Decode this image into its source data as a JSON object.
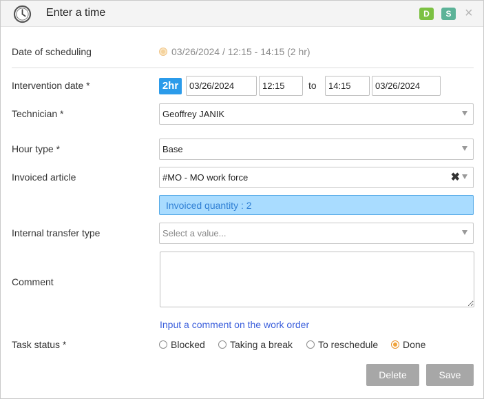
{
  "header": {
    "title": "Enter a time",
    "badge_d": "D",
    "badge_s": "S",
    "close_glyph": "×"
  },
  "fields": {
    "scheduling": {
      "label": "Date of scheduling",
      "value": "03/26/2024 / 12:15 - 14:15 (2 hr)"
    },
    "intervention": {
      "label": "Intervention date *",
      "duration_badge": "2hr",
      "start_date": "03/26/2024",
      "start_time": "12:15",
      "to_label": "to",
      "end_time": "14:15",
      "end_date": "03/26/2024"
    },
    "technician": {
      "label": "Technician *",
      "value": "Geoffrey JANIK"
    },
    "hour_type": {
      "label": "Hour type *",
      "value": "Base"
    },
    "invoiced_article": {
      "label": "Invoiced article",
      "value": "#MO - MO work force",
      "clear_glyph": "✖",
      "quantity_text": "Invoiced quantity : 2"
    },
    "transfer_type": {
      "label": "Internal transfer type",
      "placeholder": "Select a value..."
    },
    "comment": {
      "label": "Comment",
      "value": "",
      "link_text": "Input a comment on the work order"
    },
    "task_status": {
      "label": "Task status *",
      "options": [
        "Blocked",
        "Taking a break",
        "To reschedule",
        "Done"
      ],
      "selected": "Done"
    }
  },
  "buttons": {
    "delete": "Delete",
    "save": "Save"
  },
  "colors": {
    "accent_blue": "#2b9bea",
    "badge_green": "#7cc142",
    "badge_teal": "#5cb398",
    "radio_selected": "#f0a33b",
    "button_gray": "#a7a7a7"
  },
  "icons": {
    "header": "clock-icon",
    "close": "close-icon"
  }
}
